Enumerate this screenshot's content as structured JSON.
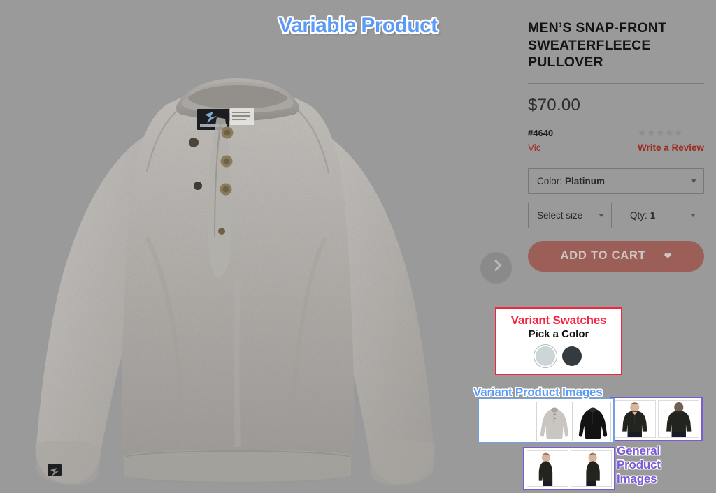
{
  "overlay_title": "Variable Product",
  "background_color": "#9a9a9a",
  "product": {
    "title": "MEN’S SNAP-FRONT SWEATERFLEECE PULLOVER",
    "price": "$70.00",
    "sku": "#4640",
    "brand": "Vic",
    "stars": "★★★★★",
    "star_count": 5,
    "star_filled": 0,
    "write_review": "Write a Review",
    "color_label": "Color:",
    "color_value": "Platinum",
    "size_label": "Select size",
    "qty_label": "Qty:",
    "qty_value": "1",
    "add_to_cart": "ADD TO CART",
    "wishlist_icon": "heart-icon",
    "next_arrow_icon": "chevron-right-icon"
  },
  "annotations": {
    "variant_swatches": {
      "label": "Variant Swatches",
      "color": "#f4253f",
      "heading": "Pick a Color",
      "swatches": [
        {
          "name": "Platinum",
          "hex": "#ccd5d8",
          "selected": true
        },
        {
          "name": "Charcoal",
          "hex": "#343a3f",
          "selected": false
        }
      ]
    },
    "variant_product_images": {
      "label": "Variant Product Images",
      "color": "#5c9bf5",
      "thumbnails": [
        {
          "name": "platinum-pullover-flat",
          "tone": "light"
        },
        {
          "name": "charcoal-pullover-flat",
          "tone": "dark"
        }
      ]
    },
    "general_product_images": {
      "label": "General\nProduct\nImages",
      "color": "#7a5ad6",
      "thumbnails_top": [
        {
          "name": "model-front-view",
          "pose": "front"
        },
        {
          "name": "model-back-view",
          "pose": "back"
        }
      ],
      "thumbnails_bottom": [
        {
          "name": "model-side-left-view",
          "pose": "side-left"
        },
        {
          "name": "model-side-right-view",
          "pose": "side-right"
        }
      ]
    }
  }
}
